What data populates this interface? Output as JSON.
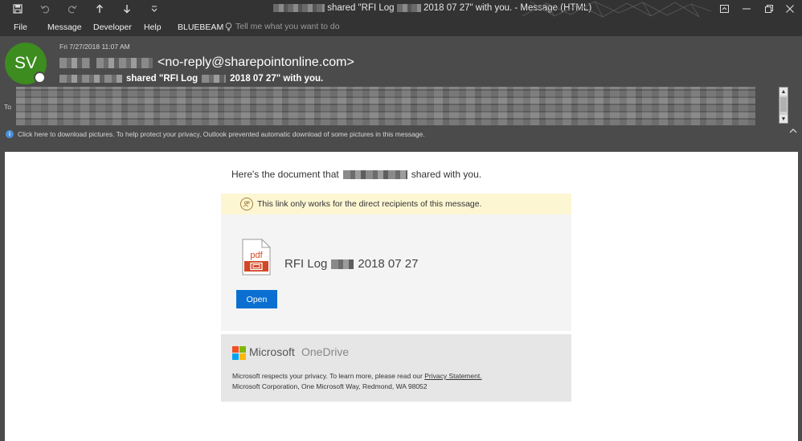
{
  "window": {
    "title_prefix": "shared \"RFI Log",
    "title_middle": "2018 07 27\" with you.",
    "title_suffix": "-  Message (HTML)"
  },
  "menu": {
    "items": [
      "File",
      "Message",
      "Developer",
      "Help",
      "BLUEBEAM"
    ],
    "tell_me_placeholder": "Tell me what you want to do"
  },
  "header": {
    "avatar_initials": "SV",
    "date": "Fri 7/27/2018 11:07 AM",
    "sender_email": "<no-reply@sharepointonline.com>",
    "subject_prefix": "shared \"RFI Log",
    "subject_suffix": "2018 07 27\" with you.",
    "to_label": "To",
    "info_message": "Click here to download pictures. To help protect your privacy, Outlook prevented automatic download of some pictures in this message."
  },
  "email": {
    "intro_prefix": "Here's the document that",
    "intro_suffix": "shared with you.",
    "warning": "This link only works for the direct recipients of this message.",
    "file_icon_text": "pdf",
    "doc_name_prefix": "RFI Log",
    "doc_name_suffix": "2018 07 27",
    "open_button": "Open",
    "brand_microsoft": "Microsoft",
    "brand_onedrive": "OneDrive",
    "privacy_text": "Microsoft respects your privacy. To learn more, please read our",
    "privacy_link": "Privacy Statement.",
    "address": "Microsoft Corporation, One Microsoft Way, Redmond, WA 98052"
  },
  "colors": {
    "accent_blue": "#0a6fd0",
    "avatar_green": "#3c8c1f",
    "pdf_red": "#d24726",
    "ms_red": "#f25022",
    "ms_green": "#7fba00",
    "ms_blue": "#00a4ef",
    "ms_yellow": "#ffb900"
  }
}
